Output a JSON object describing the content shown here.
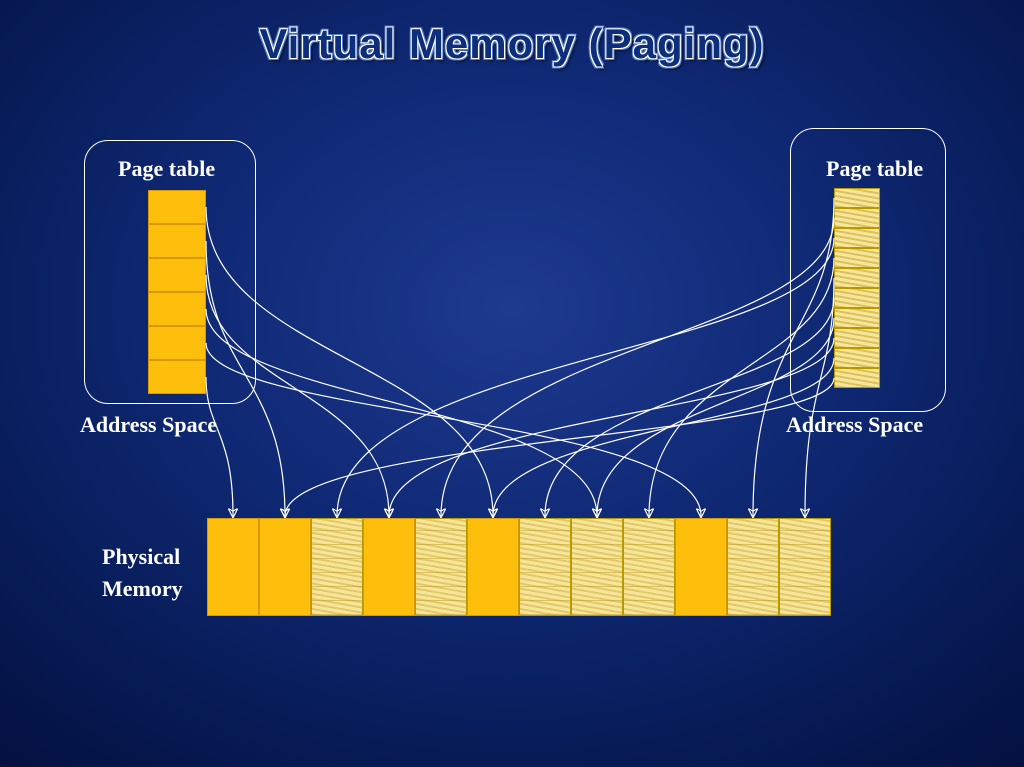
{
  "title": "Virtual Memory (Paging)",
  "left": {
    "page_table_label": "Page table",
    "address_space_label": "Address Space",
    "cells": 6
  },
  "right": {
    "page_table_label": "Page table",
    "address_space_label": "Address Space",
    "cells": 10
  },
  "physical_memory": {
    "label_line1": "Physical",
    "label_line2": "Memory",
    "cells": [
      {
        "type": "solid"
      },
      {
        "type": "solid"
      },
      {
        "type": "hatched"
      },
      {
        "type": "solid"
      },
      {
        "type": "hatched"
      },
      {
        "type": "solid"
      },
      {
        "type": "hatched"
      },
      {
        "type": "hatched"
      },
      {
        "type": "hatched"
      },
      {
        "type": "solid"
      },
      {
        "type": "hatched"
      },
      {
        "type": "hatched"
      }
    ]
  },
  "arrows": {
    "left_targets": [
      6,
      2,
      4,
      8,
      10,
      1
    ],
    "right_targets": [
      11,
      5,
      3,
      9,
      12,
      7,
      8,
      4,
      6,
      2
    ]
  }
}
